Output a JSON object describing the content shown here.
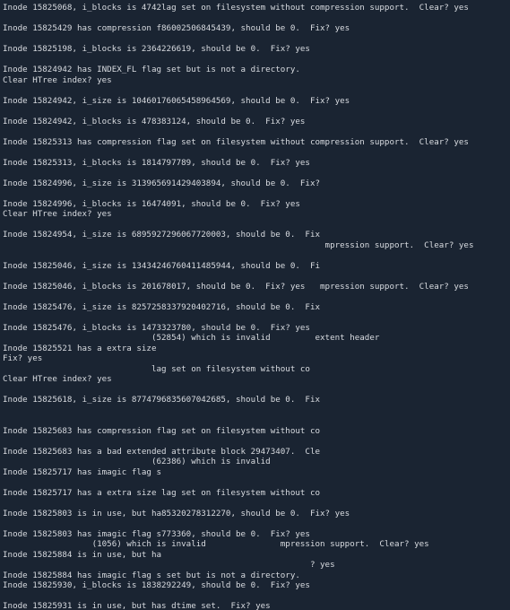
{
  "terminal": {
    "lines": [
      "Inode 15825068, i_blocks is 4742lag set on filesystem without compression support.  Clear? yes",
      "",
      "Inode 15825429 has compression f86002506845439, should be 0.  Fix? yes",
      "",
      "Inode 15825198, i_blocks is 2364226619, should be 0.  Fix? yes",
      "",
      "Inode 15824942 has INDEX_FL flag set but is not a directory.",
      "Clear HTree index? yes",
      "",
      "Inode 15824942, i_size is 10460176065458964569, should be 0.  Fix? yes",
      "",
      "Inode 15824942, i_blocks is 478383124, should be 0.  Fix? yes",
      "",
      "Inode 15825313 has compression flag set on filesystem without compression support.  Clear? yes",
      "",
      "Inode 15825313, i_blocks is 1814797789, should be 0.  Fix? yes",
      "",
      "Inode 15824996, i_size is 313965691429403894, should be 0.  Fix?",
      "",
      "Inode 15824996, i_blocks is 16474091, should be 0.  Fix? yes",
      "Clear HTree index? yes",
      "",
      "Inode 15824954, i_size is 6895927296067720003, should be 0.  Fix",
      "                                                                 mpression support.  Clear? yes",
      "",
      "Inode 15825046, i_size is 13434246760411485944, should be 0.  Fi",
      "",
      "Inode 15825046, i_blocks is 201678017, should be 0.  Fix? yes   mpression support.  Clear? yes",
      "",
      "Inode 15825476, i_size is 8257258337920402716, should be 0.  Fix",
      "",
      "Inode 15825476, i_blocks is 1473323780, should be 0.  Fix? yes",
      "                              (52854) which is invalid         extent header",
      "Inode 15825521 has a extra size",
      "Fix? yes",
      "                              lag set on filesystem without co",
      "Clear HTree index? yes",
      "",
      "Inode 15825618, i_size is 8774796835607042685, should be 0.  Fix",
      "",
      "",
      "Inode 15825683 has compression flag set on filesystem without co",
      "",
      "Inode 15825683 has a bad extended attribute block 29473407.  Cle",
      "                              (62386) which is invalid",
      "Inode 15825717 has imagic flag s",
      "",
      "Inode 15825717 has a extra size lag set on filesystem without co",
      "",
      "Inode 15825803 is in use, but ha85320278312270, should be 0.  Fix? yes",
      "",
      "Inode 15825803 has imagic flag s773360, should be 0.  Fix? yes",
      "                  (1056) which is invalid               mpression support.  Clear? yes",
      "Inode 15825884 is in use, but ha",
      "                                                              ? yes",
      "Inode 15825884 has imagic flag s set but is not a directory.",
      "Inode 15825930, i_blocks is 1838292249, should be 0.  Fix? yes",
      "",
      "Inode 15825931 is in use, but has dtime set.  Fix? yes"
    ]
  }
}
